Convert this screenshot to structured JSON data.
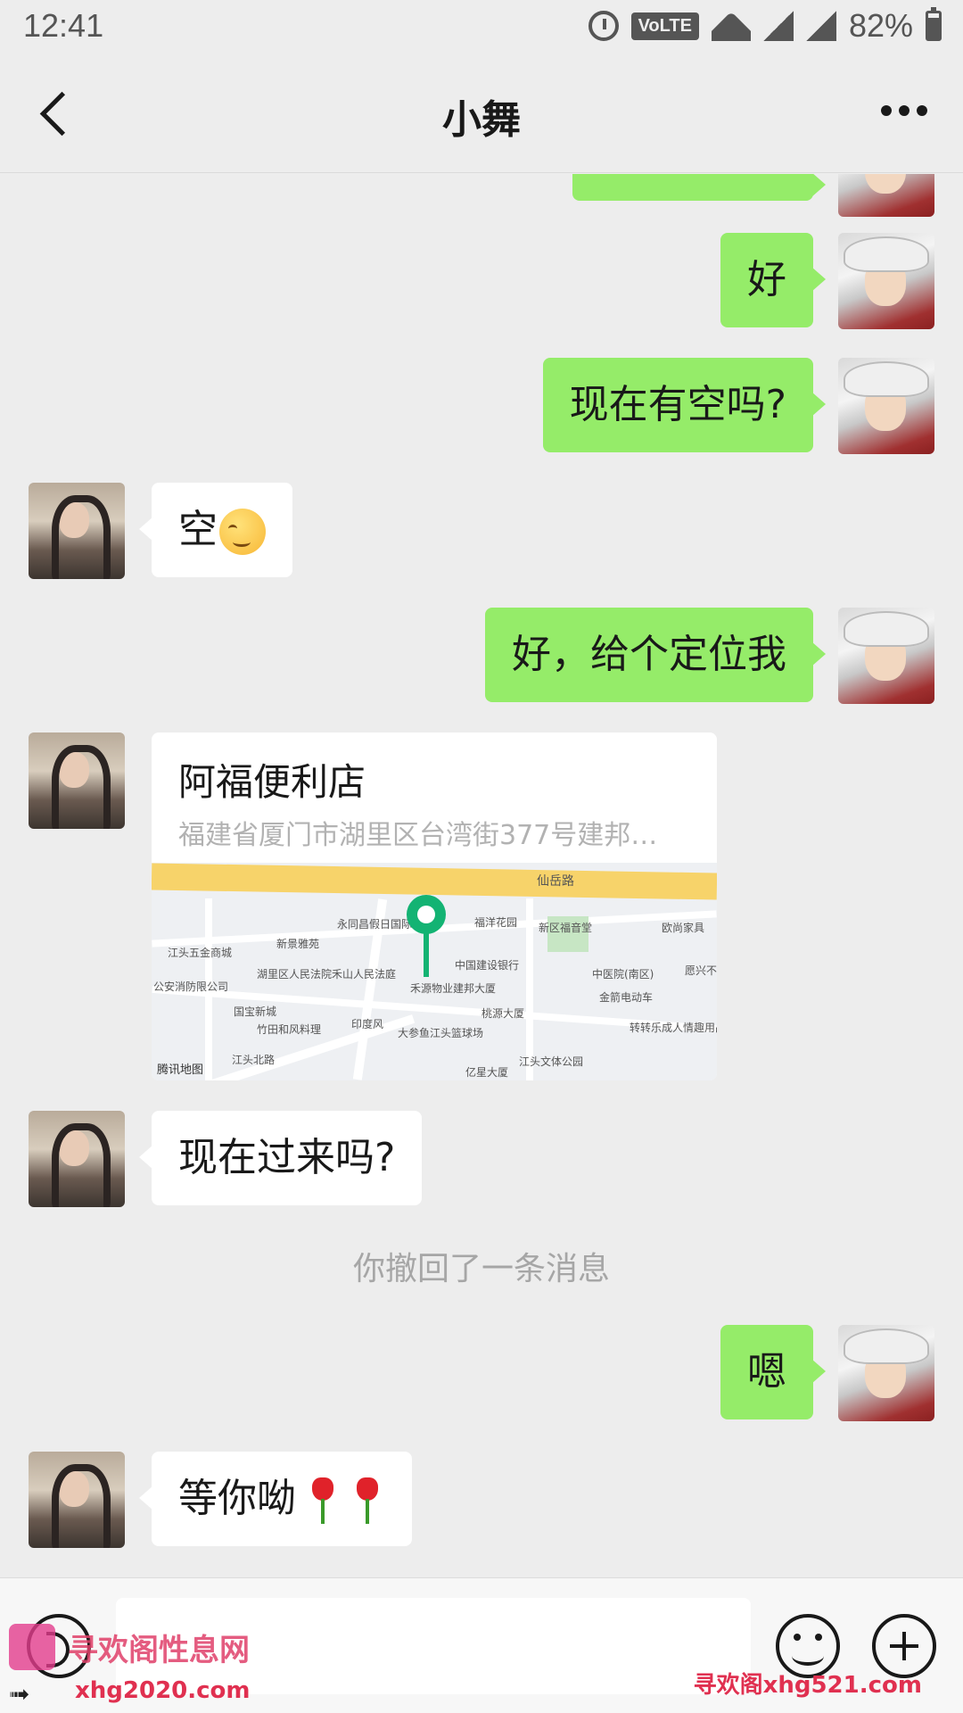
{
  "status_bar": {
    "time": "12:41",
    "network_badge": "VoLTE",
    "battery": "82%"
  },
  "header": {
    "title": "小舞"
  },
  "messages": [
    {
      "from": "me",
      "text": "好"
    },
    {
      "from": "me",
      "text": "现在有空吗?"
    },
    {
      "from": "her",
      "text": "空",
      "emoji": "pleased-face-emoji"
    },
    {
      "from": "me",
      "text": "好，给个定位我"
    },
    {
      "from": "her",
      "type": "location",
      "name": "阿福便利店",
      "address": "福建省厦门市湖里区台湾街377号建邦…"
    },
    {
      "from": "her",
      "text": "现在过来吗?"
    },
    {
      "from": "me",
      "text": "嗯"
    },
    {
      "from": "her",
      "text": "等你呦",
      "emoji": "rose-emoji"
    }
  ],
  "system_message": "你撤回了一条消息",
  "map": {
    "labels": [
      "仙岳路",
      "永同昌假日国际公寓",
      "福洋花园",
      "新区福音堂",
      "欧尚家具",
      "新景雅苑",
      "江头五金商城",
      "中国建设银行",
      "湖里区人民法院禾山人民法庭",
      "中医院(南区)",
      "愿兴不锈",
      "公安消防限公司",
      "国宝新城",
      "禾源物业建邦大厦",
      "金箭电动车",
      "桃源大厦",
      "竹田和风料理",
      "印度风",
      "大参鱼江头篮球场",
      "转转乐成人情趣用品",
      "江头北路",
      "江头文体公园",
      "亿星大厦"
    ],
    "brand": "腾讯地图"
  },
  "watermark": {
    "site_name": "寻欢阁性息网",
    "url_left": "xhg2020.com",
    "url_right": "寻欢阁xhg521.com"
  },
  "colors": {
    "my_bubble": "#95ec69",
    "her_bubble": "#ffffff",
    "background": "#ededed",
    "map_pin": "#13b373"
  }
}
